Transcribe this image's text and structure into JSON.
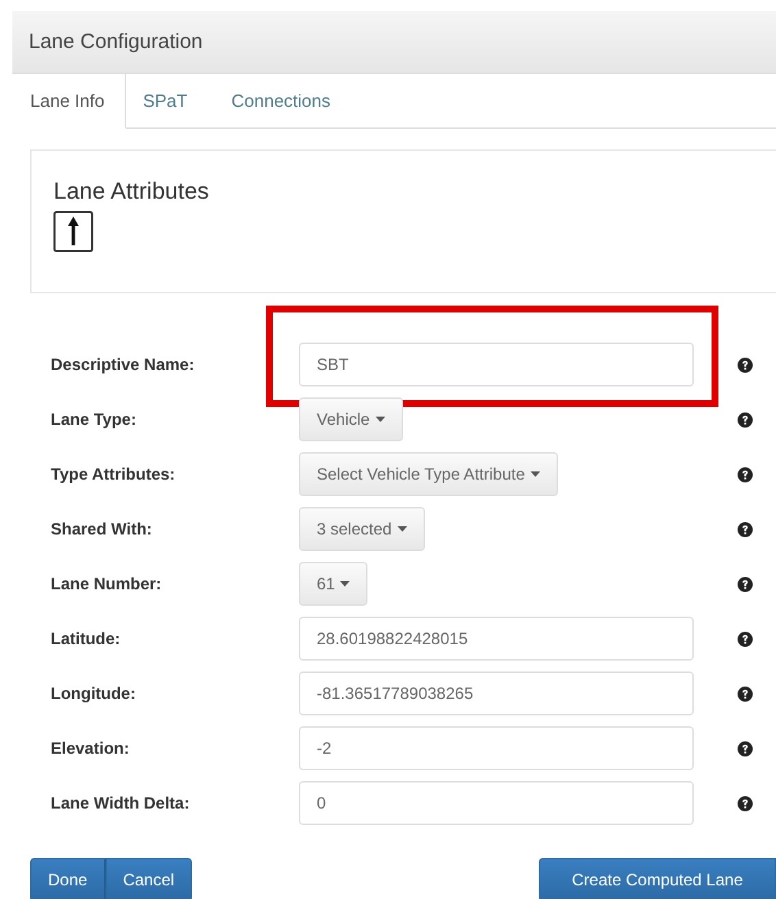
{
  "header": {
    "title": "Lane Configuration"
  },
  "tabs": [
    {
      "label": "Lane Info",
      "selected": true
    },
    {
      "label": "SPaT",
      "selected": false
    },
    {
      "label": "Connections",
      "selected": false
    }
  ],
  "panel": {
    "title": "Lane Attributes"
  },
  "fields": [
    {
      "label": "Descriptive Name:",
      "kind": "text",
      "value": "SBT",
      "highlighted": true
    },
    {
      "label": "Lane Type:",
      "kind": "dropdown",
      "value": "Vehicle",
      "highlighted": false
    },
    {
      "label": "Type Attributes:",
      "kind": "dropdown",
      "value": "Select Vehicle Type Attribute",
      "highlighted": false
    },
    {
      "label": "Shared With:",
      "kind": "dropdown",
      "value": "3 selected",
      "highlighted": false
    },
    {
      "label": "Lane Number:",
      "kind": "dropdown",
      "value": "61",
      "highlighted": false
    },
    {
      "label": "Latitude:",
      "kind": "text",
      "value": "28.60198822428015",
      "highlighted": false
    },
    {
      "label": "Longitude:",
      "kind": "text",
      "value": "-81.36517789038265",
      "highlighted": false
    },
    {
      "label": "Elevation:",
      "kind": "text",
      "value": "-2",
      "highlighted": false
    },
    {
      "label": "Lane Width Delta:",
      "kind": "text",
      "value": "0",
      "highlighted": false
    }
  ],
  "buttons": {
    "left": [
      "Done",
      "Cancel"
    ],
    "right": "Create Computed Lane"
  }
}
